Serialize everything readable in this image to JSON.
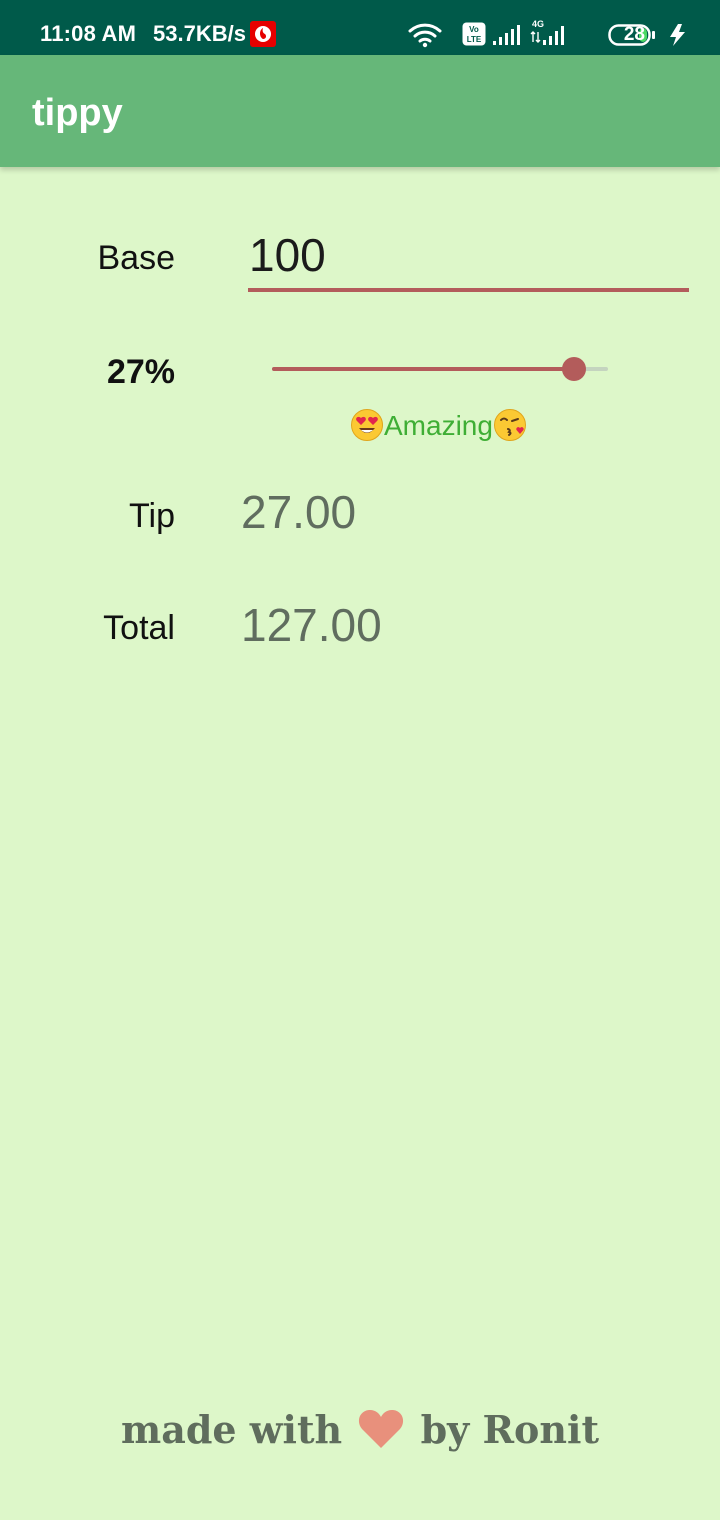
{
  "status_bar": {
    "time": "11:08 AM",
    "network_speed": "53.7KB/s",
    "volte_label": "Vo LTE",
    "network_type": "4G",
    "battery_level": "28",
    "icons": [
      "vodafone-icon",
      "wifi-icon",
      "volte-icon",
      "signal-icon",
      "signal-4g-icon",
      "battery-icon",
      "charging-icon"
    ]
  },
  "app_bar": {
    "title": "tippy"
  },
  "form": {
    "base_label": "Base",
    "base_value": "100",
    "percent_label": "27%",
    "tip_percent": 27,
    "slider_max": 30,
    "tip_description": "Amazing",
    "tip_description_icons": [
      "heart-eyes-emoji-icon",
      "kissing-heart-emoji-icon"
    ],
    "tip_label": "Tip",
    "tip_amount": "27.00",
    "total_label": "Total",
    "total_amount": "127.00"
  },
  "footer": {
    "prefix": "made with",
    "icon": "heart-icon",
    "suffix": "by Ronit"
  },
  "colors": {
    "status_bar": "#005a4a",
    "app_bar": "#66b779",
    "background": "#ddf7c9",
    "accent": "#b35c5b",
    "description": "#3fae35",
    "value_text": "#606d5f",
    "heart": "#e8907c"
  }
}
